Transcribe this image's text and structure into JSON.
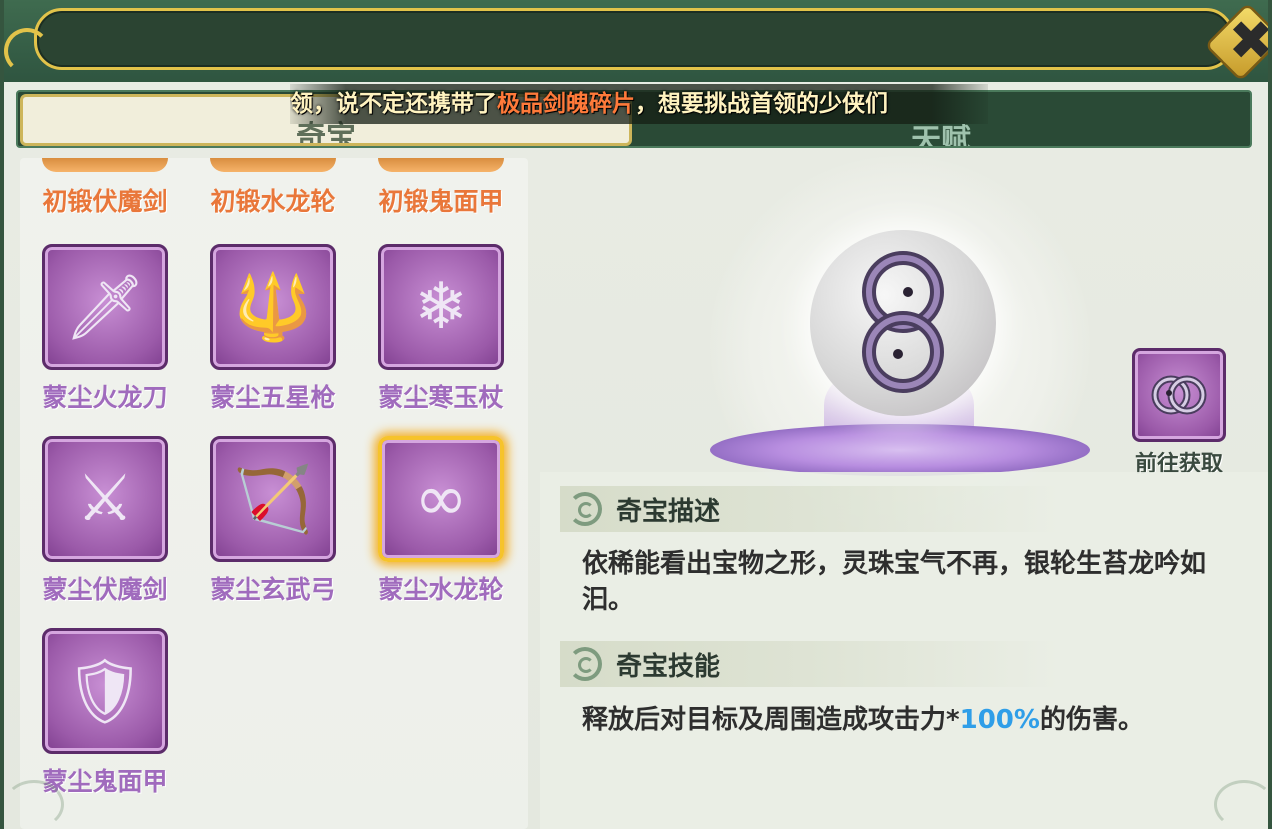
{
  "header": {
    "close_icon": "close-x-icon"
  },
  "tabs": [
    {
      "label": "奇宝",
      "active": true
    },
    {
      "label": "天赋",
      "active": false
    }
  ],
  "marquee": {
    "prefix": "领，说不定还携带了",
    "highlight": "极品剑魄碎片",
    "suffix": "，想要挑战首领的少侠们",
    "highlight_color": "#ff7a3a"
  },
  "items": [
    {
      "name": "初锻伏魔剑",
      "color": "orange",
      "partial": true
    },
    {
      "name": "初锻水龙轮",
      "color": "orange",
      "partial": true
    },
    {
      "name": "初锻鬼面甲",
      "color": "orange",
      "partial": true
    },
    {
      "name": "蒙尘火龙刀",
      "color": "purple",
      "icon": "fire-dragon-blade-icon",
      "glyph": "🗡"
    },
    {
      "name": "蒙尘五星枪",
      "color": "purple",
      "icon": "five-star-spear-icon",
      "glyph": "🔱"
    },
    {
      "name": "蒙尘寒玉杖",
      "color": "purple",
      "icon": "jade-staff-icon",
      "glyph": "❄"
    },
    {
      "name": "蒙尘伏魔剑",
      "color": "purple",
      "icon": "demon-sword-icon",
      "glyph": "⚔"
    },
    {
      "name": "蒙尘玄武弓",
      "color": "purple",
      "icon": "xuanwu-bow-icon",
      "glyph": "🏹"
    },
    {
      "name": "蒙尘水龙轮",
      "color": "purple",
      "icon": "water-dragon-wheel-icon",
      "glyph": "∞",
      "selected": true
    },
    {
      "name": "蒙尘鬼面甲",
      "color": "purple",
      "icon": "ghost-armor-icon",
      "glyph": "🛡"
    }
  ],
  "showcase": {
    "item_icon": "water-dragon-wheel-icon",
    "goto_label": "前往获取",
    "goto_icon": "water-dragon-wheel-icon"
  },
  "description": {
    "title": "奇宝描述",
    "text": "依稀能看出宝物之形，灵珠宝气不再，银轮生苔龙吟如汩。"
  },
  "skill": {
    "title": "奇宝技能",
    "text_before": "释放后对目标及周围造成攻击力*",
    "percent": "100%",
    "text_after": "的伤害。",
    "percent_color": "#2f9ee8"
  }
}
